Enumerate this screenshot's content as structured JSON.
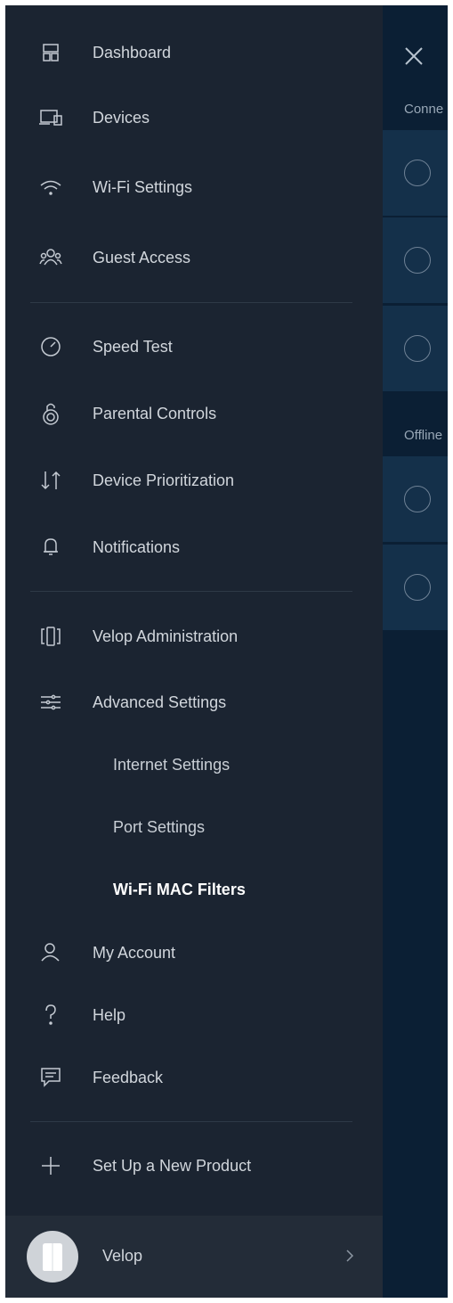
{
  "background": {
    "sections": [
      "Conne",
      "Offline"
    ],
    "connected_rows": 3,
    "offline_rows": 2
  },
  "menu": {
    "items": [
      {
        "label": "Dashboard",
        "icon": "dashboard-icon"
      },
      {
        "label": "Devices",
        "icon": "devices-icon"
      },
      {
        "label": "Wi-Fi Settings",
        "icon": "wifi-icon"
      },
      {
        "label": "Guest Access",
        "icon": "guest-icon"
      },
      {
        "label": "Speed Test",
        "icon": "speedometer-icon"
      },
      {
        "label": "Parental Controls",
        "icon": "lock-icon"
      },
      {
        "label": "Device Prioritization",
        "icon": "arrows-icon"
      },
      {
        "label": "Notifications",
        "icon": "bell-icon"
      },
      {
        "label": "Velop Administration",
        "icon": "velop-nodes-icon"
      },
      {
        "label": "Advanced Settings",
        "icon": "sliders-icon"
      },
      {
        "label": "Internet Settings"
      },
      {
        "label": "Port Settings"
      },
      {
        "label": "Wi-Fi MAC Filters",
        "active": true
      },
      {
        "label": "My Account",
        "icon": "user-icon"
      },
      {
        "label": "Help",
        "icon": "help-icon"
      },
      {
        "label": "Feedback",
        "icon": "feedback-icon"
      },
      {
        "label": "Set Up a New Product",
        "icon": "plus-icon"
      }
    ]
  },
  "footer": {
    "label": "Velop",
    "icon": "velop-node-icon"
  },
  "colors": {
    "drawer": "#1b2431",
    "background": "#0a1e33",
    "row": "#14304a",
    "text": "#d1d6dc"
  }
}
